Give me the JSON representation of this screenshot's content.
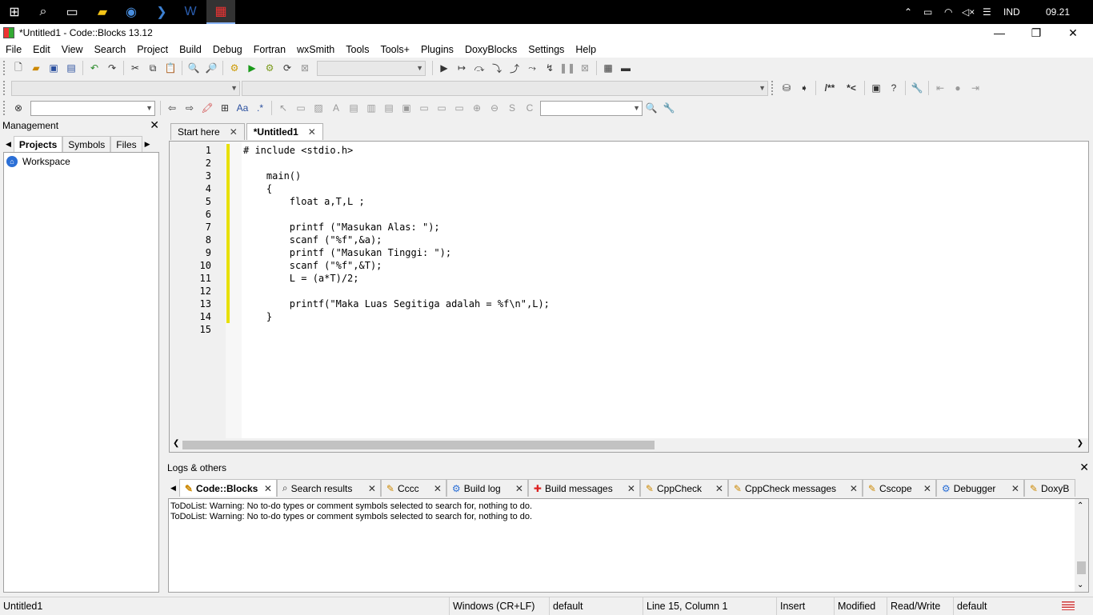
{
  "taskbar": {
    "icons": [
      "windows-start-icon",
      "search-icon",
      "task-view-icon",
      "file-explorer-icon",
      "browser-icon",
      "powershell-icon",
      "word-icon",
      "codeblocks-icon"
    ],
    "language": "IND",
    "time": "09.21"
  },
  "window": {
    "title": "*Untitled1 - Code::Blocks 13.12"
  },
  "menu": [
    "File",
    "Edit",
    "View",
    "Search",
    "Project",
    "Build",
    "Debug",
    "Fortran",
    "wxSmith",
    "Tools",
    "Tools+",
    "Plugins",
    "DoxyBlocks",
    "Settings",
    "Help"
  ],
  "toolbar": {
    "doxy_comment_block": "/**",
    "doxy_comment_line": "*<"
  },
  "management": {
    "title": "Management",
    "tabs": [
      "Projects",
      "Symbols",
      "Files"
    ],
    "tree_root": "Workspace"
  },
  "editor": {
    "tabs": [
      "Start here",
      "*Untitled1"
    ],
    "line_numbers": [
      "1",
      "2",
      "3",
      "4",
      "5",
      "6",
      "7",
      "8",
      "9",
      "10",
      "11",
      "12",
      "13",
      "14",
      "15"
    ],
    "lines": [
      "# include <stdio.h>",
      "",
      "    main()",
      "    {",
      "        float a,T,L ;",
      "",
      "        printf (\"Masukan Alas: \");",
      "        scanf (\"%f\",&a);",
      "        printf (\"Masukan Tinggi: \");",
      "        scanf (\"%f\",&T);",
      "        L = (a*T)/2;",
      "",
      "        printf(\"Maka Luas Segitiga adalah = %f\\n\",L);",
      "    }",
      ""
    ]
  },
  "logs": {
    "title": "Logs & others",
    "tabs": [
      "Code::Blocks",
      "Search results",
      "Cccc",
      "Build log",
      "Build messages",
      "CppCheck",
      "CppCheck messages",
      "Cscope",
      "Debugger",
      "DoxyB"
    ],
    "messages": [
      "ToDoList: Warning: No to-do types or comment symbols selected to search for, nothing to do.",
      "ToDoList: Warning: No to-do types or comment symbols selected to search for, nothing to do."
    ]
  },
  "status": {
    "file": "Untitled1",
    "line_endings": "Windows (CR+LF)",
    "encoding": "default",
    "position": "Line 15, Column 1",
    "mode": "Insert",
    "modified": "Modified",
    "access": "Read/Write",
    "profile": "default"
  }
}
